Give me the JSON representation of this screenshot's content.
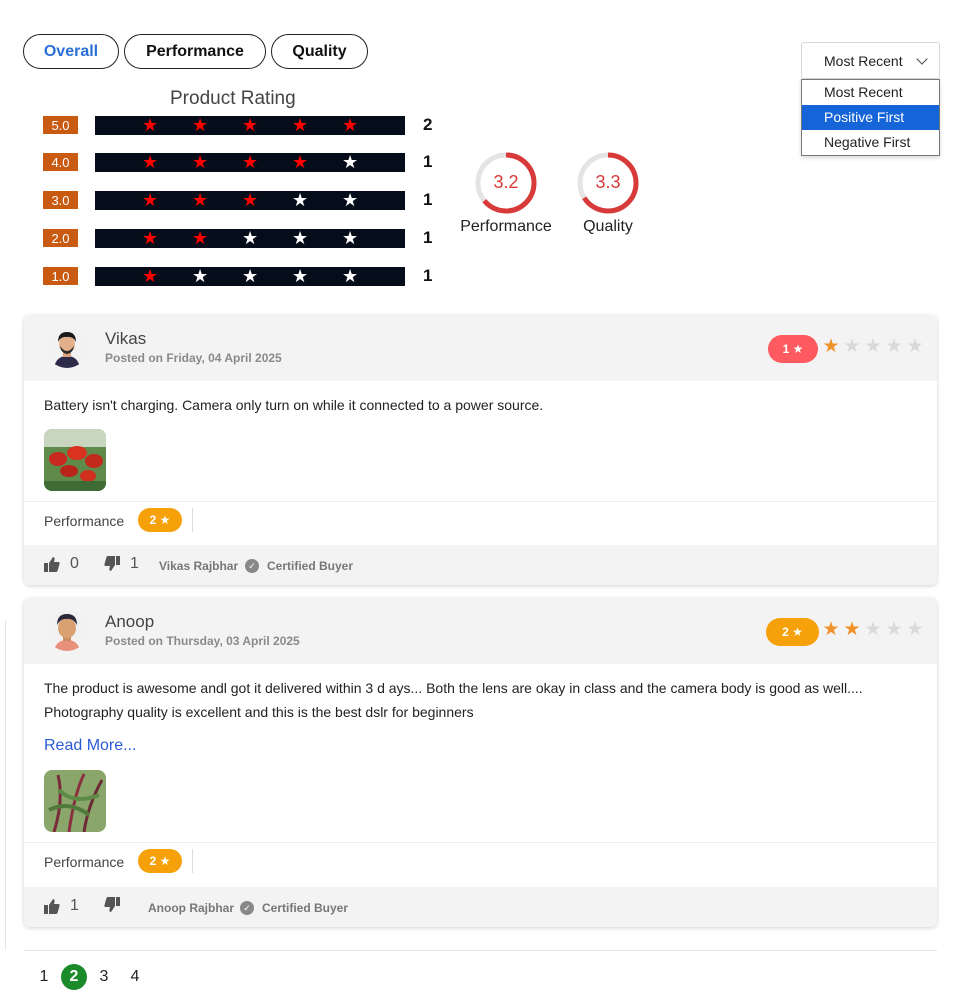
{
  "tabs": [
    {
      "label": "Overall",
      "active": true
    },
    {
      "label": "Performance",
      "active": false
    },
    {
      "label": "Quality",
      "active": false
    }
  ],
  "sort": {
    "selected": "Most Recent",
    "options": [
      "Most Recent",
      "Positive First",
      "Negative First"
    ],
    "highlighted": "Positive First"
  },
  "rating_summary": {
    "title": "Product Rating",
    "rows": [
      {
        "label": "5.0",
        "stars": 5,
        "count": "2"
      },
      {
        "label": "4.0",
        "stars": 4,
        "count": "1"
      },
      {
        "label": "3.0",
        "stars": 3,
        "count": "1"
      },
      {
        "label": "2.0",
        "stars": 2,
        "count": "1"
      },
      {
        "label": "1.0",
        "stars": 1,
        "count": "1"
      }
    ],
    "circles": [
      {
        "value": "3.2",
        "label": "Performance",
        "fraction": 0.64
      },
      {
        "value": "3.3",
        "label": "Quality",
        "fraction": 0.66
      }
    ]
  },
  "colors": {
    "accent": "#2a6fd6",
    "rating_badge": "#c85a12",
    "star_filled": "#ff0000",
    "star_empty": "#ffffff",
    "circle": "#d83a3a",
    "pill_low": "#ff5a5f",
    "pill_mid": "#f6a109",
    "pager_active": "#1a8a2a"
  },
  "reviews": [
    {
      "name": "Vikas",
      "posted": "Posted on Friday, 04 April 2025",
      "rating": 1,
      "rating_pill": "1 ★",
      "text": "Battery isn't charging. Camera only turn on while it connected to a power source.",
      "attribute_label": "Performance",
      "attribute_pill": "2 ★",
      "likes": "0",
      "dislikes": "1",
      "buyer": "Vikas Rajbhar",
      "certified": "Certified Buyer"
    },
    {
      "name": "Anoop",
      "posted": "Posted on Thursday, 03 April 2025",
      "rating": 2,
      "rating_pill": "2 ★",
      "text": "The product is awesome andl got it delivered within 3 d ays... Both the lens are okay in class and the camera body is good as well.... Photography quality is excellent and this is the best dslr for beginners",
      "read_more": "Read More...",
      "attribute_label": "Performance",
      "attribute_pill": "2 ★",
      "likes": "1",
      "dislikes": "",
      "buyer": "Anoop Rajbhar",
      "certified": "Certified Buyer"
    }
  ],
  "pagination": {
    "pages": [
      "1",
      "2",
      "3",
      "4"
    ],
    "current": "2"
  }
}
